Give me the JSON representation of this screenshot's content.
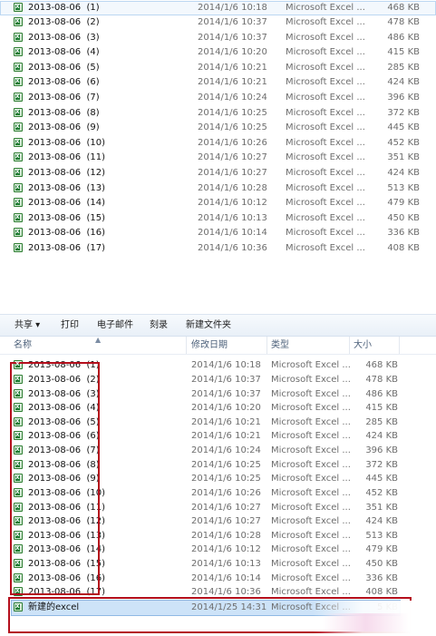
{
  "top_list": [
    {
      "name": "2013-08-06  (1)",
      "date": "2014/1/6 10:18",
      "type": "Microsoft Excel ...",
      "size": "468 KB"
    },
    {
      "name": "2013-08-06  (2)",
      "date": "2014/1/6 10:37",
      "type": "Microsoft Excel ...",
      "size": "478 KB"
    },
    {
      "name": "2013-08-06  (3)",
      "date": "2014/1/6 10:37",
      "type": "Microsoft Excel ...",
      "size": "486 KB"
    },
    {
      "name": "2013-08-06  (4)",
      "date": "2014/1/6 10:20",
      "type": "Microsoft Excel ...",
      "size": "415 KB"
    },
    {
      "name": "2013-08-06  (5)",
      "date": "2014/1/6 10:21",
      "type": "Microsoft Excel ...",
      "size": "285 KB"
    },
    {
      "name": "2013-08-06  (6)",
      "date": "2014/1/6 10:21",
      "type": "Microsoft Excel ...",
      "size": "424 KB"
    },
    {
      "name": "2013-08-06  (7)",
      "date": "2014/1/6 10:24",
      "type": "Microsoft Excel ...",
      "size": "396 KB"
    },
    {
      "name": "2013-08-06  (8)",
      "date": "2014/1/6 10:25",
      "type": "Microsoft Excel ...",
      "size": "372 KB"
    },
    {
      "name": "2013-08-06  (9)",
      "date": "2014/1/6 10:25",
      "type": "Microsoft Excel ...",
      "size": "445 KB"
    },
    {
      "name": "2013-08-06  (10)",
      "date": "2014/1/6 10:26",
      "type": "Microsoft Excel ...",
      "size": "452 KB"
    },
    {
      "name": "2013-08-06  (11)",
      "date": "2014/1/6 10:27",
      "type": "Microsoft Excel ...",
      "size": "351 KB"
    },
    {
      "name": "2013-08-06  (12)",
      "date": "2014/1/6 10:27",
      "type": "Microsoft Excel ...",
      "size": "424 KB"
    },
    {
      "name": "2013-08-06  (13)",
      "date": "2014/1/6 10:28",
      "type": "Microsoft Excel ...",
      "size": "513 KB"
    },
    {
      "name": "2013-08-06  (14)",
      "date": "2014/1/6 10:12",
      "type": "Microsoft Excel ...",
      "size": "479 KB"
    },
    {
      "name": "2013-08-06  (15)",
      "date": "2014/1/6 10:13",
      "type": "Microsoft Excel ...",
      "size": "450 KB"
    },
    {
      "name": "2013-08-06  (16)",
      "date": "2014/1/6 10:14",
      "type": "Microsoft Excel ...",
      "size": "336 KB"
    },
    {
      "name": "2013-08-06  (17)",
      "date": "2014/1/6 10:36",
      "type": "Microsoft Excel ...",
      "size": "408 KB"
    }
  ],
  "toolbar": {
    "share": "共享 ▾",
    "print": "打印",
    "email": "电子邮件",
    "burn": "刻录",
    "new_folder": "新建文件夹"
  },
  "columns": {
    "name": "名称",
    "modified": "修改日期",
    "type": "类型",
    "size": "大小"
  },
  "bottom_list": [
    {
      "name": "2013-08-06  (1)",
      "date": "2014/1/6 10:18",
      "type": "Microsoft Excel ...",
      "size": "468 KB"
    },
    {
      "name": "2013-08-06  (2)",
      "date": "2014/1/6 10:37",
      "type": "Microsoft Excel ...",
      "size": "478 KB"
    },
    {
      "name": "2013-08-06  (3)",
      "date": "2014/1/6 10:37",
      "type": "Microsoft Excel ...",
      "size": "486 KB"
    },
    {
      "name": "2013-08-06  (4)",
      "date": "2014/1/6 10:20",
      "type": "Microsoft Excel ...",
      "size": "415 KB"
    },
    {
      "name": "2013-08-06  (5)",
      "date": "2014/1/6 10:21",
      "type": "Microsoft Excel ...",
      "size": "285 KB"
    },
    {
      "name": "2013-08-06  (6)",
      "date": "2014/1/6 10:21",
      "type": "Microsoft Excel ...",
      "size": "424 KB"
    },
    {
      "name": "2013-08-06  (7)",
      "date": "2014/1/6 10:24",
      "type": "Microsoft Excel ...",
      "size": "396 KB"
    },
    {
      "name": "2013-08-06  (8)",
      "date": "2014/1/6 10:25",
      "type": "Microsoft Excel ...",
      "size": "372 KB"
    },
    {
      "name": "2013-08-06  (9)",
      "date": "2014/1/6 10:25",
      "type": "Microsoft Excel ...",
      "size": "445 KB"
    },
    {
      "name": "2013-08-06  (10)",
      "date": "2014/1/6 10:26",
      "type": "Microsoft Excel ...",
      "size": "452 KB"
    },
    {
      "name": "2013-08-06  (11)",
      "date": "2014/1/6 10:27",
      "type": "Microsoft Excel ...",
      "size": "351 KB"
    },
    {
      "name": "2013-08-06  (12)",
      "date": "2014/1/6 10:27",
      "type": "Microsoft Excel ...",
      "size": "424 KB"
    },
    {
      "name": "2013-08-06  (13)",
      "date": "2014/1/6 10:28",
      "type": "Microsoft Excel ...",
      "size": "513 KB"
    },
    {
      "name": "2013-08-06  (14)",
      "date": "2014/1/6 10:12",
      "type": "Microsoft Excel ...",
      "size": "479 KB"
    },
    {
      "name": "2013-08-06  (15)",
      "date": "2014/1/6 10:13",
      "type": "Microsoft Excel ...",
      "size": "450 KB"
    },
    {
      "name": "2013-08-06  (16)",
      "date": "2014/1/6 10:14",
      "type": "Microsoft Excel ...",
      "size": "336 KB"
    },
    {
      "name": "2013-08-06  (17)",
      "date": "2014/1/6 10:36",
      "type": "Microsoft Excel ...",
      "size": "408 KB"
    }
  ],
  "new_file": {
    "name": "新建的excel",
    "date": "2014/1/25 14:31",
    "type": "Microsoft Excel ...",
    "size": "5 KB"
  },
  "icons": {
    "file": "excel-file-icon",
    "sort": "sort-up-icon"
  },
  "colors": {
    "highlight_border": "#b40f1c",
    "selection_fill": "#cde3f8",
    "selection_border": "#8fb9e4",
    "toolbar_bg": "#e9f0f8"
  }
}
